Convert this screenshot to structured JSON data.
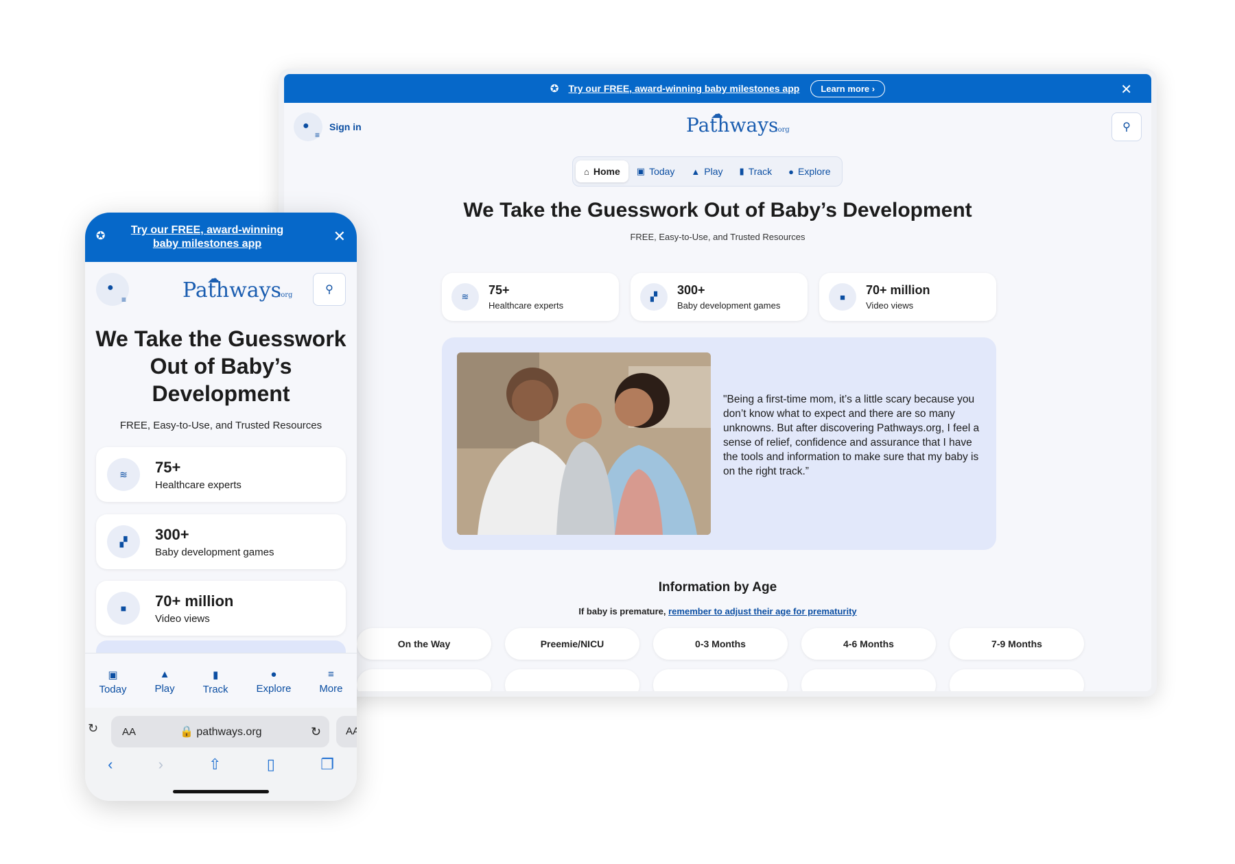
{
  "desktop": {
    "banner": {
      "text": "Try our FREE, award-winning baby milestones app",
      "learn_more": "Learn more",
      "close": "✕"
    },
    "signin": "Sign in",
    "logo": {
      "text": "Pathways",
      "suffix": ".org"
    },
    "nav": [
      {
        "label": "Home",
        "icon": "⌂"
      },
      {
        "label": "Today",
        "icon": "▣"
      },
      {
        "label": "Play",
        "icon": "▲"
      },
      {
        "label": "Track",
        "icon": "▮"
      },
      {
        "label": "Explore",
        "icon": "●"
      }
    ],
    "hero": {
      "title": "We Take the Guesswork Out of Baby’s Development",
      "subtitle": "FREE, Easy-to-Use, and Trusted Resources"
    },
    "stats": [
      {
        "num": "75+",
        "label": "Healthcare experts",
        "icon": "≋"
      },
      {
        "num": "300+",
        "label": "Baby development games",
        "icon": "▞"
      },
      {
        "num": "70+ million",
        "label": "Video views",
        "icon": "■"
      }
    ],
    "testimonial": "\"Being a first-time mom, it’s a little scary because you don’t know what to expect and there are so many unknowns. But after discovering Pathways.org, I feel a sense of relief, confidence and assurance that I have the tools and information to make sure that my baby is on the right track.”",
    "info": {
      "title": "Information by Age",
      "sub_prefix": "If baby is premature,",
      "sub_link": "remember to adjust their age for prematurity",
      "ages": [
        "On the Way",
        "Preemie/NICU",
        "0-3 Months",
        "4-6 Months",
        "7-9 Months"
      ]
    }
  },
  "mobile": {
    "banner": {
      "text": "Try our FREE, award-winning baby milestones app",
      "close": "✕"
    },
    "tabs": [
      {
        "label": "Today",
        "icon": "▣"
      },
      {
        "label": "Play",
        "icon": "▲"
      },
      {
        "label": "Track",
        "icon": "▮"
      },
      {
        "label": "Explore",
        "icon": "●"
      },
      {
        "label": "More",
        "icon": "≡"
      }
    ],
    "browser": {
      "aa": "AA",
      "url": "pathways.org",
      "partial": "AA"
    }
  },
  "colors": {
    "brand_blue": "#0668c9",
    "link_blue": "#0b4ea2",
    "panel_lavender": "#e2e8fa"
  }
}
